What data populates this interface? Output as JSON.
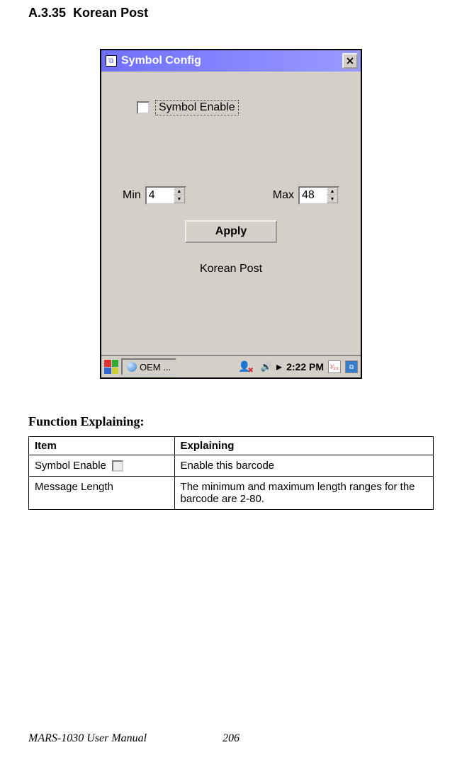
{
  "section": {
    "number": "A.3.35",
    "title": "Korean Post"
  },
  "dialog": {
    "title": "Symbol Config",
    "symbol_enable_label": "Symbol Enable",
    "min_label": "Min",
    "min_value": "4",
    "max_label": "Max",
    "max_value": "48",
    "apply_label": "Apply",
    "caption": "Korean Post"
  },
  "taskbar": {
    "task_label": "OEM ...",
    "clock": "2:22 PM"
  },
  "function": {
    "heading": "Function Explaining:",
    "header_item": "Item",
    "header_explaining": "Explaining",
    "rows": [
      {
        "item": "Symbol Enable",
        "has_checkbox": true,
        "explaining": "Enable this barcode"
      },
      {
        "item": "Message Length",
        "has_checkbox": false,
        "explaining": "The minimum and maximum length ranges for the barcode are 2-80."
      }
    ]
  },
  "footer": {
    "manual": "MARS-1030 User Manual",
    "page": "206"
  }
}
